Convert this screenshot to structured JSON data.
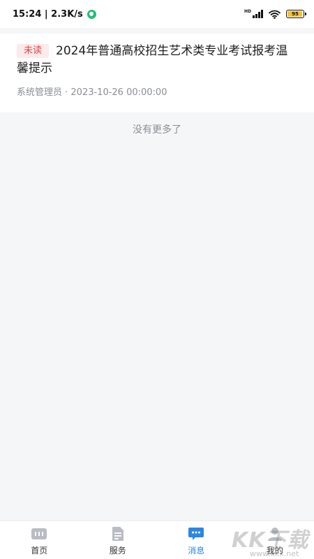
{
  "status_bar": {
    "time_speed": "15:24 | 2.3K/s",
    "network_label": "HD",
    "battery_level": "95"
  },
  "message": {
    "badge": "未读",
    "title": "2024年普通高校招生艺术类专业考试报考温馨提示",
    "meta": "系统管理员 · 2023-10-26 00:00:00"
  },
  "list_footer": "没有更多了",
  "tabs": [
    {
      "label": "首页",
      "icon": "home-icon",
      "active": false
    },
    {
      "label": "服务",
      "icon": "document-icon",
      "active": false
    },
    {
      "label": "消息",
      "icon": "message-icon",
      "active": true
    },
    {
      "label": "我的",
      "icon": "user-icon",
      "active": false
    }
  ],
  "colors": {
    "accent": "#2b86e6",
    "badge_bg": "#fdeaea",
    "badge_text": "#e0464a",
    "inactive_icon": "#b9bcc2"
  },
  "watermark": {
    "brand": "KK下载",
    "url": "www.kkx.net"
  }
}
